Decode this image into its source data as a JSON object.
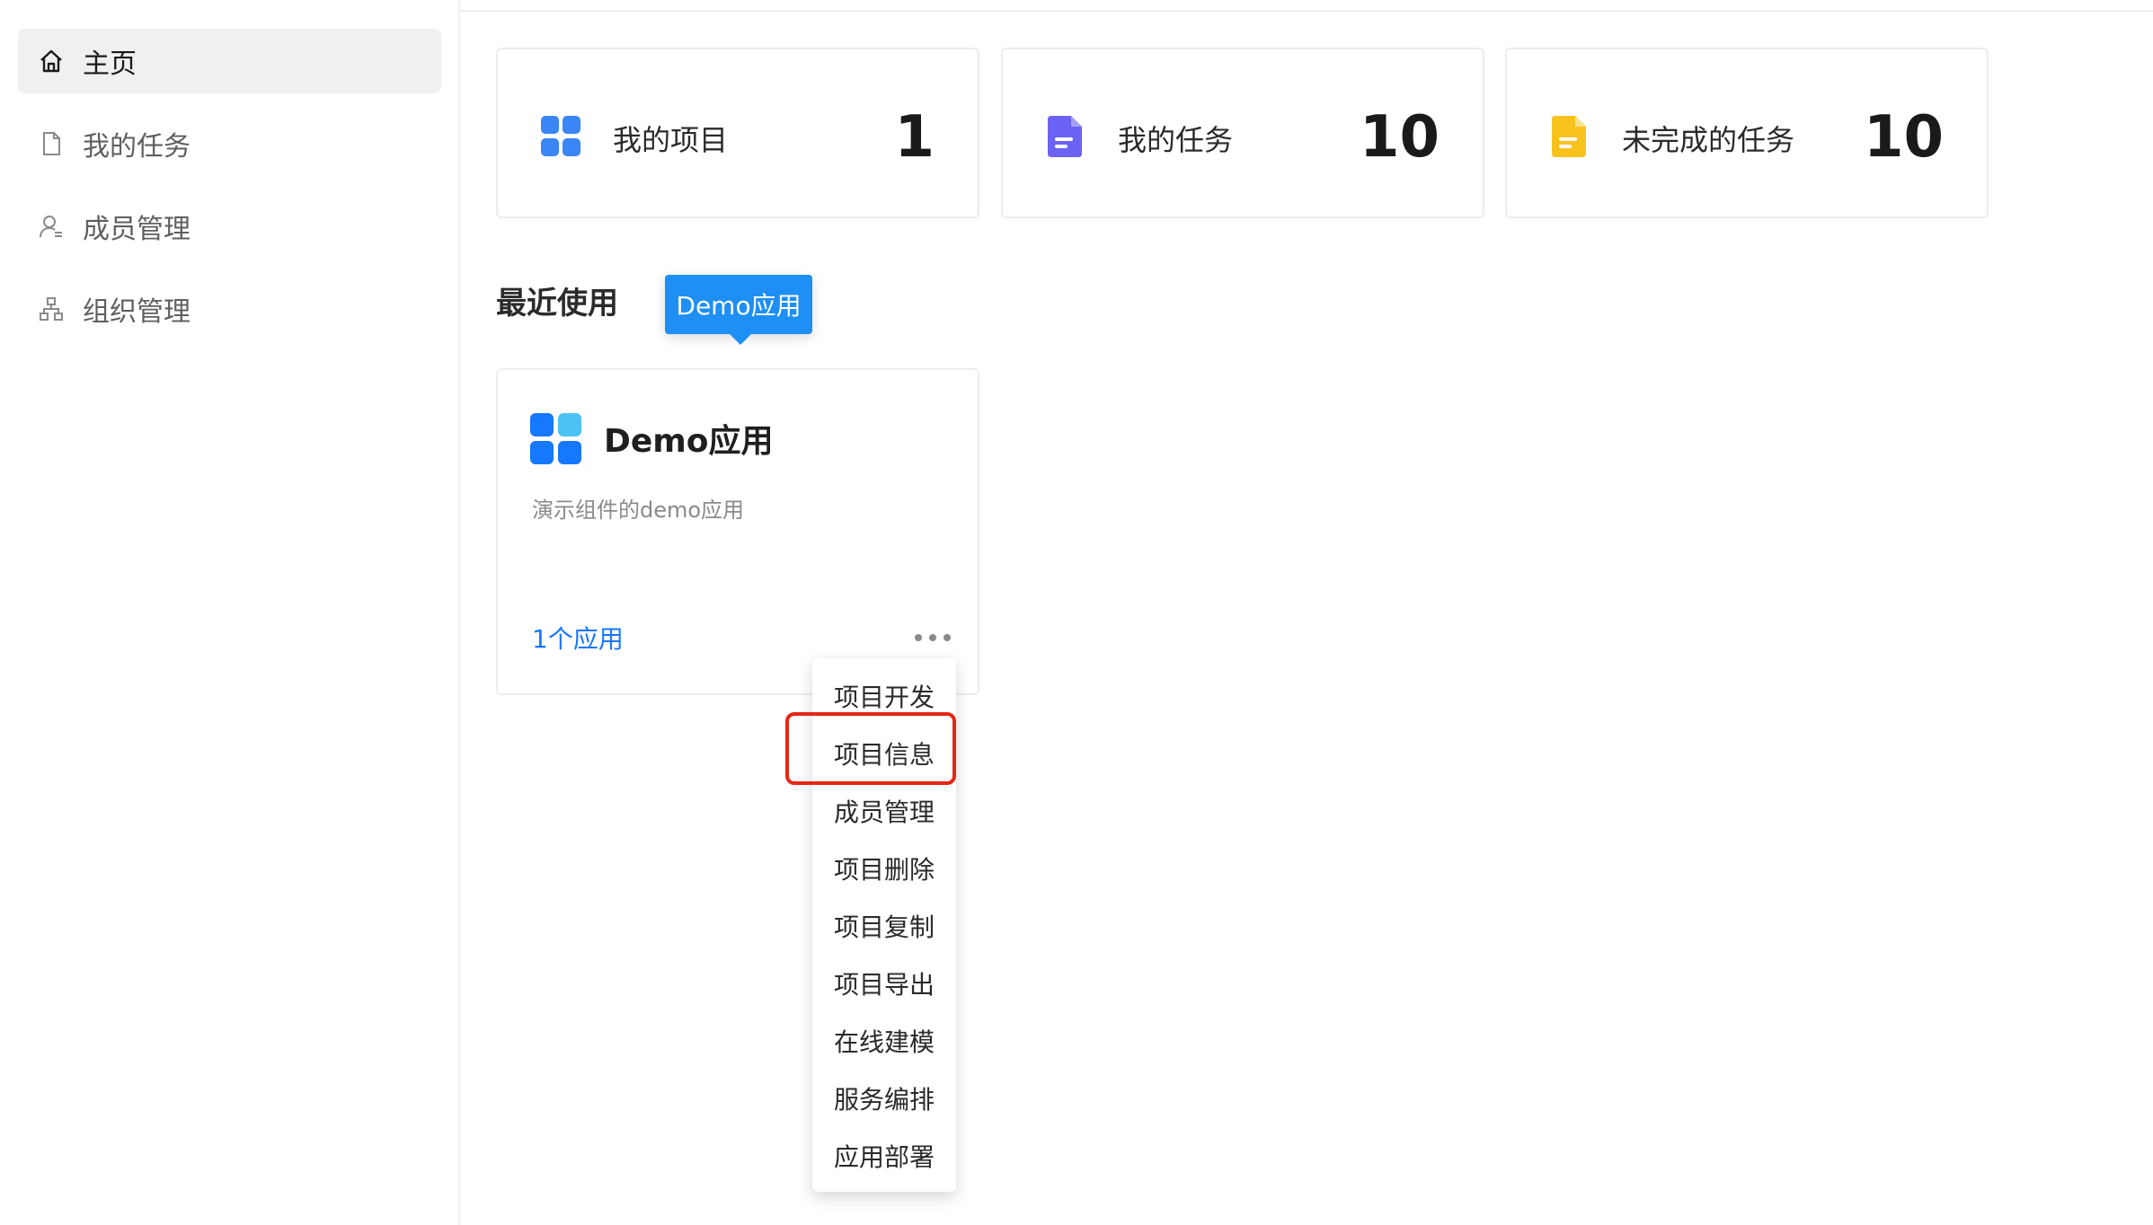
{
  "sidebar": {
    "items": [
      {
        "label": "主页",
        "icon": "home-icon",
        "active": true
      },
      {
        "label": "我的任务",
        "icon": "document-icon",
        "active": false
      },
      {
        "label": "成员管理",
        "icon": "user-settings-icon",
        "active": false
      },
      {
        "label": "组织管理",
        "icon": "org-chart-icon",
        "active": false
      }
    ]
  },
  "stats": [
    {
      "label": "我的项目",
      "value": "1",
      "icon": "grid-apps-icon",
      "color": "#3a86f7"
    },
    {
      "label": "我的任务",
      "value": "10",
      "icon": "purple-document-icon",
      "color": "#6c63f5"
    },
    {
      "label": "未完成的任务",
      "value": "10",
      "icon": "yellow-document-icon",
      "color": "#f8c21c"
    }
  ],
  "recent": {
    "title": "最近使用",
    "tooltip": "Demo应用",
    "card": {
      "name": "Demo应用",
      "description": "演示组件的demo应用",
      "count_label": "1个应用"
    }
  },
  "menu": {
    "items": [
      "项目开发",
      "项目信息",
      "成员管理",
      "项目删除",
      "项目复制",
      "项目导出",
      "在线建模",
      "服务编排",
      "应用部署"
    ],
    "highlighted": "项目信息"
  },
  "colors": {
    "accent": "#1677ff",
    "tooltip": "#1e8ff5",
    "highlight": "#e52616"
  }
}
